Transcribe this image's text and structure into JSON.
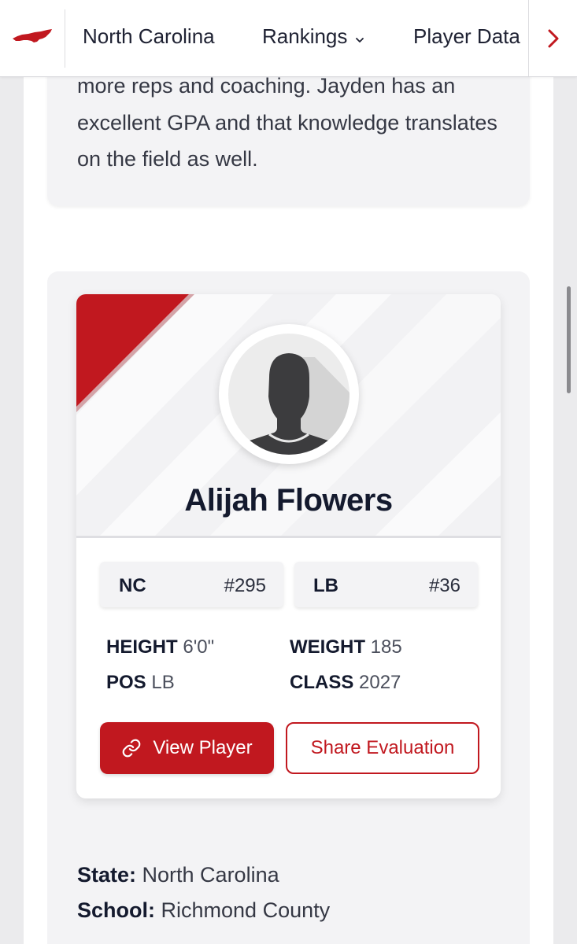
{
  "nav": {
    "state": "North Carolina",
    "rankings": "Rankings",
    "player_data": "Player Data"
  },
  "evaluation_text": "more reps and coaching. Jayden has an excellent GPA and that knowledge translates on the field as well.",
  "player": {
    "name": "Alijah Flowers",
    "state_abbr": "NC",
    "state_rank": "#295",
    "position_abbr": "LB",
    "position_rank": "#36",
    "height_label": "HEIGHT",
    "height": "6'0\"",
    "weight_label": "WEIGHT",
    "weight": "185",
    "pos_label": "POS",
    "pos": "LB",
    "class_label": "CLASS",
    "class": "2027"
  },
  "buttons": {
    "view_player": "View Player",
    "share_evaluation": "Share Evaluation"
  },
  "details": {
    "state_label": "State:",
    "state": "North Carolina",
    "school_label": "School:",
    "school": "Richmond County"
  },
  "icons": [
    "nc-state-logo",
    "chevron-down-icon",
    "chevron-right-icon",
    "link-icon",
    "avatar-silhouette"
  ],
  "colors": {
    "accent": "#c1181f",
    "text_dark": "#141a2e",
    "card_bg": "#f3f3f5"
  }
}
